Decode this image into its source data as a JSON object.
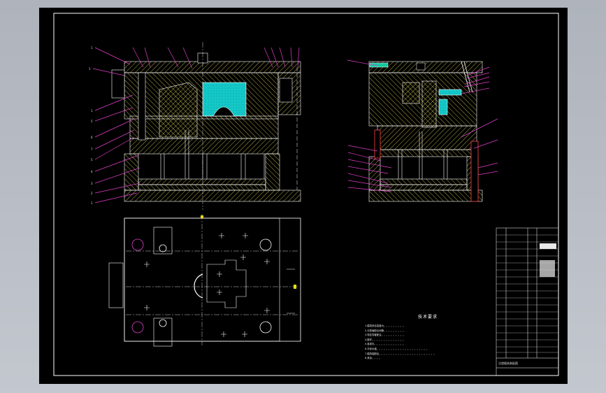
{
  "drawing": {
    "background_color": "#000000",
    "viewport_color": "#b4b9c1",
    "line_colors": {
      "outline": "#ffffff",
      "hatch": "#d8d25a",
      "accent_fill": "#14c8c8",
      "leader": "#e040c8",
      "centerline": "#ffffff",
      "marker": "#e8e000"
    }
  },
  "technical_requirements": {
    "title": "技术要求",
    "lines": [
      "1.模具闭合高度为。。。。。。。。。",
      "2.分型面配合间隙。。。。。。。。。",
      "3.导柱导套配合。。。。。。。。。。",
      "4.推杆。。。。。。。。。。。。。。",
      "5.各零件。。。。。。。。。。。。。",
      "6.冷却水道。。。。。。。。。。。。。。。。。。。。。。",
      "7.模具装配后。。。。。。。。。。。。。。。。。。。。。。。。",
      "8.其余。。。。"
    ]
  },
  "title_block": {
    "label": "注塑模具装配图"
  }
}
